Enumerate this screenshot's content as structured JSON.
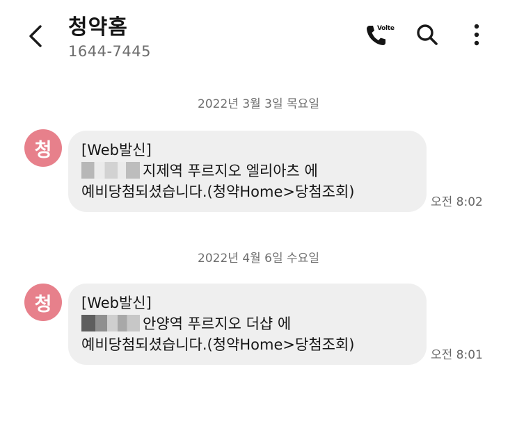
{
  "header": {
    "contact_name": "청약홈",
    "contact_number": "1644-7445",
    "call_badge": "Volte"
  },
  "conversation": [
    {
      "date": "2022년 3월 3일 목요일",
      "sender_initial": "청",
      "lines": [
        "[Web발신]",
        "지제역 푸르지오 엘리아츠 에",
        "예비당첨되셨습니다.(청약Home>당첨조회)"
      ],
      "time": "오전 8:02"
    },
    {
      "date": "2022년 4월 6일 수요일",
      "sender_initial": "청",
      "lines": [
        "[Web발신]",
        "안양역 푸르지오 더샵 에",
        "예비당첨되셨습니다.(청약Home>당첨조회)"
      ],
      "time": "오전 8:01"
    }
  ],
  "colors": {
    "avatar": "#e7808b",
    "bubble": "#efefef",
    "secondary_text": "#6f6f6f"
  },
  "icons": {
    "back": "chevron-left-icon",
    "call": "phone-icon",
    "search": "search-icon",
    "more": "more-vertical-icon"
  }
}
